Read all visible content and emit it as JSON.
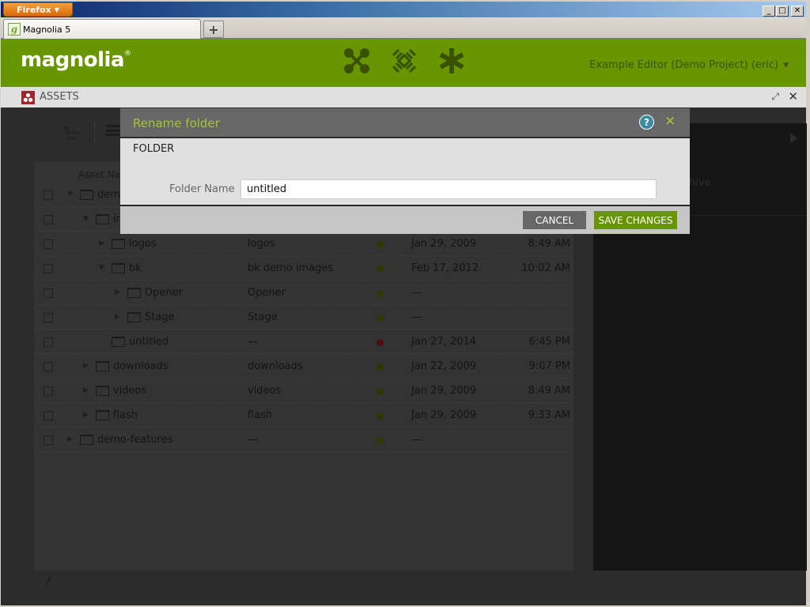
{
  "browser": {
    "menu_button": "Firefox",
    "tab_title": "Magnolia 5",
    "new_tab_label": "+",
    "window_controls": [
      "minimize",
      "maximize",
      "close"
    ]
  },
  "header": {
    "logo": "magnolia",
    "logo_mark": "®",
    "app_icons": [
      "applauncher-icon",
      "pulse-icon",
      "favorites-icon"
    ],
    "user_menu": "Example Editor (Demo Project) (eric)",
    "brand_color": "#689600"
  },
  "app": {
    "title": "ASSETS",
    "badge_color": "#a0262b"
  },
  "browser_panel": {
    "column_header": "Asset Name",
    "rows": [
      {
        "name": "demo",
        "title": "",
        "status": "published",
        "date": "",
        "time": "",
        "level": 0,
        "expanded": true
      },
      {
        "name": "img",
        "title": "",
        "status": "published",
        "date": "",
        "time": "",
        "level": 1,
        "expanded": true
      },
      {
        "name": "logos",
        "title": "logos",
        "status": "published",
        "date": "Jan 29, 2009",
        "time": "8:49 AM",
        "level": 2,
        "expanded": false
      },
      {
        "name": "bk",
        "title": "bk demo images",
        "status": "published",
        "date": "Feb 17, 2012",
        "time": "10:02 AM",
        "level": 2,
        "expanded": true
      },
      {
        "name": "Opener",
        "title": "Opener",
        "status": "published",
        "date": "—",
        "time": "",
        "level": 3,
        "expanded": false
      },
      {
        "name": "Stage",
        "title": "Stage",
        "status": "published",
        "date": "—",
        "time": "",
        "level": 3,
        "expanded": false
      },
      {
        "name": "untitled",
        "title": "—",
        "status": "unpublished",
        "date": "Jan 27, 2014",
        "time": "6:45 PM",
        "level": 2,
        "expanded": null
      },
      {
        "name": "downloads",
        "title": "downloads",
        "status": "published",
        "date": "Jan 22, 2009",
        "time": "9:07 PM",
        "level": 1,
        "expanded": false
      },
      {
        "name": "videos",
        "title": "videos",
        "status": "published",
        "date": "Jan 29, 2009",
        "time": "8:49 AM",
        "level": 1,
        "expanded": false
      },
      {
        "name": "flash",
        "title": "flash",
        "status": "published",
        "date": "Jan 29, 2009",
        "time": "9:33 AM",
        "level": 1,
        "expanded": false
      },
      {
        "name": "demo-features",
        "title": "—",
        "status": "published",
        "date": "—",
        "time": "",
        "level": 0,
        "expanded": false
      }
    ],
    "status_colors": {
      "published": "#2a3a00",
      "unpublished": "#4a1010"
    },
    "path": "/"
  },
  "action_panel": {
    "visible_item": "Archive"
  },
  "dialog": {
    "title": "Rename folder",
    "section": "FOLDER",
    "field_label": "Folder Name",
    "field_value": "untitled",
    "cancel_label": "CANCEL",
    "save_label": "SAVE CHANGES",
    "help_icon": "?",
    "close_icon": "✕"
  }
}
